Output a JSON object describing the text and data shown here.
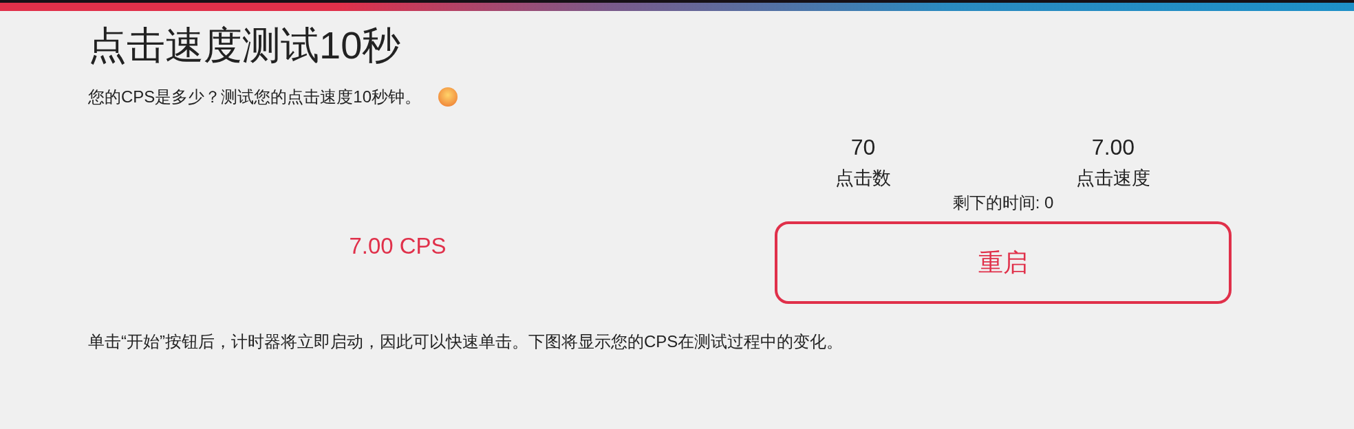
{
  "title": "点击速度测试10秒",
  "subtitle": "您的CPS是多少？测试您的点击速度10秒钟。",
  "result": "7.00 CPS",
  "stats": [
    {
      "value": "70",
      "label": "点击数"
    },
    {
      "value": "7.00",
      "label": "点击速度"
    }
  ],
  "time_left": "剩下的时间: 0",
  "restart_button": "重启",
  "description": "单击“开始”按钮后，计时器将立即启动，因此可以快速单击。下图将显示您的CPS在测试过程中的变化。"
}
